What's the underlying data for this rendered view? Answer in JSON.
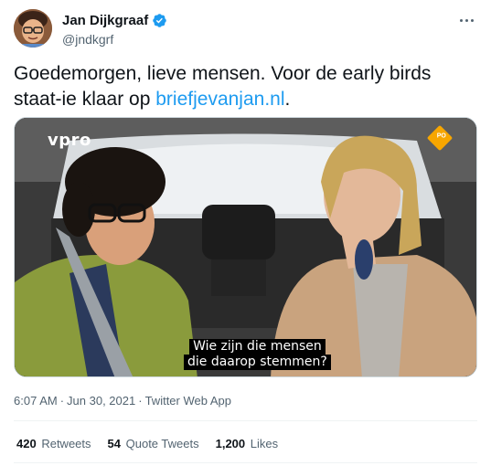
{
  "author": {
    "display_name": "Jan Dijkgraaf",
    "handle": "@jndkgrf",
    "verified_icon": "verified-badge-icon",
    "avatar_icon": "memoji-avatar"
  },
  "tweet": {
    "text_part1": "Goedemorgen, lieve mensen. Voor de early birds staat-ie klaar op ",
    "link_text": "briefjevanjan.nl",
    "text_part2": "."
  },
  "media": {
    "channel_logo": "vpro",
    "badge_text": "PO",
    "subtitle_line1": "Wie zijn die mensen",
    "subtitle_line2": "die daarop stemmen?"
  },
  "meta": {
    "time": "6:07 AM",
    "date": "Jun 30, 2021",
    "source": "Twitter Web App"
  },
  "stats": {
    "retweets_num": "420",
    "retweets_label": "Retweets",
    "quotes_num": "54",
    "quotes_label": "Quote Tweets",
    "likes_num": "1,200",
    "likes_label": "Likes"
  },
  "colors": {
    "link": "#1d9bf0",
    "secondary_text": "#536471",
    "primary_text": "#0f1419"
  }
}
